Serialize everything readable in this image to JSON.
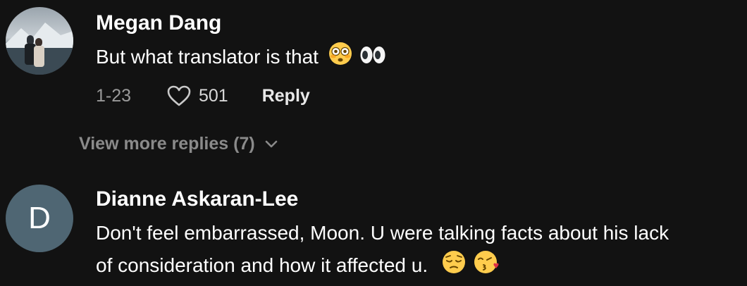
{
  "comments": [
    {
      "username": "Megan Dang",
      "text": "But what translator is that",
      "emojis": [
        "flushed-face",
        "eyes"
      ],
      "date": "1-23",
      "likes": "501",
      "reply_label": "Reply"
    },
    {
      "username": "Dianne Askaran-Lee",
      "avatar_letter": "D",
      "text_line1": "Don't feel embarrassed, Moon. U were talking facts about his lack",
      "text_line2": "of consideration and how it affected u.",
      "emojis": [
        "pensive-face",
        "kissing-heart-face"
      ]
    }
  ],
  "view_more": {
    "label": "View more replies (7)"
  },
  "colors": {
    "background": "#121212",
    "secondary_text": "#9a9a9a",
    "avatar_bg": "#4f6673"
  }
}
